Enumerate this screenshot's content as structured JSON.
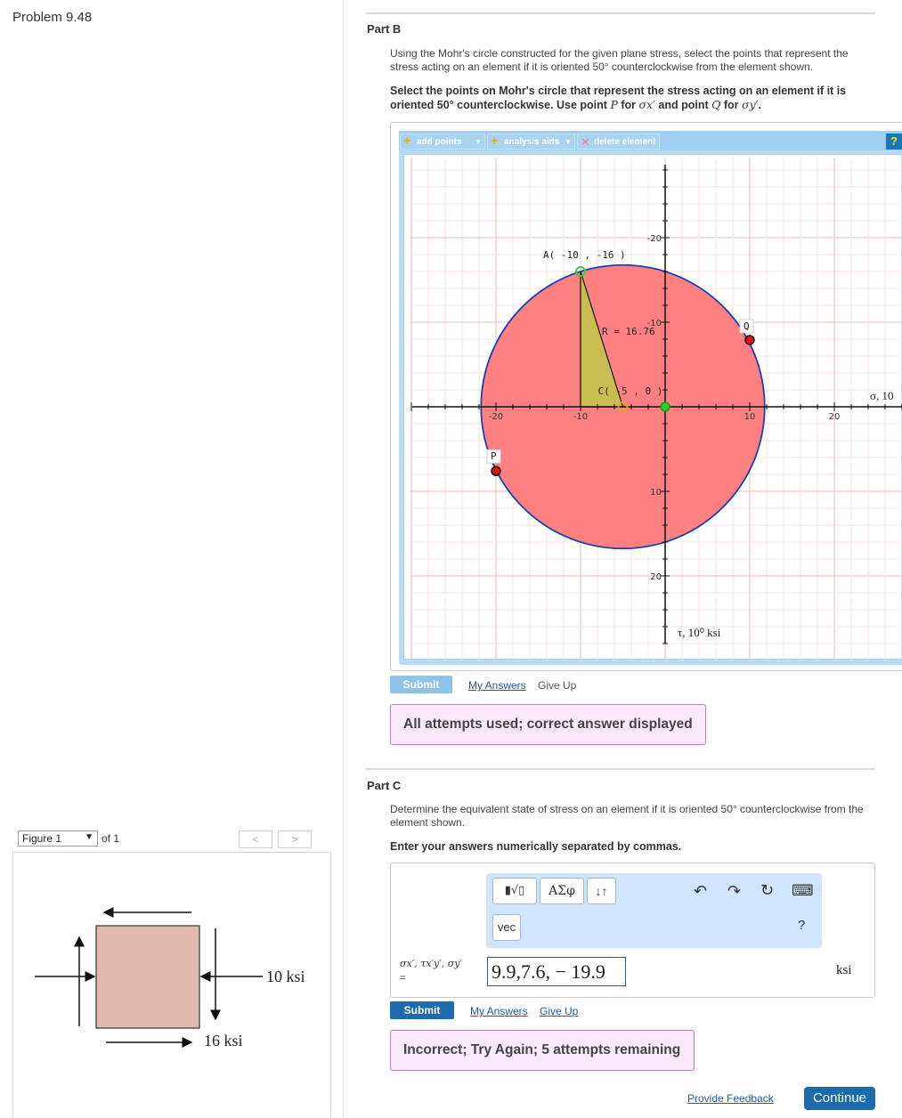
{
  "left_panel": {
    "problem_title": "Problem 9.48",
    "figure_selector": {
      "value": "Figure 1",
      "of_text": "of 1"
    },
    "nav": {
      "prev": "<",
      "next": ">"
    },
    "figure": {
      "label_top": "10 ksi",
      "label_bottom": "16 ksi"
    }
  },
  "part_b": {
    "title": "Part B",
    "description": "Using the Mohr's circle constructed for the given plane stress, select the points that represent the stress acting on an element if it is oriented 50° counterclockwise from the element shown.",
    "instruction_1": "Select the points on Mohr's circle that represent the stress acting on an element if it is oriented 50° counterclockwise. Use point",
    "point_p": "P",
    "instruction_2": "for",
    "sigma_x": "σx′",
    "instruction_3": "and point",
    "point_q": "Q",
    "instruction_4": "for",
    "sigma_y": "σy′",
    "instruction_5": ".",
    "toolbar": {
      "add_points": "add points",
      "analysis_aids": "analysis aids",
      "delete_element": "delete element",
      "help": "?"
    },
    "submit_label": "Submit",
    "my_answers_label": "My Answers",
    "give_up_label": "Give Up",
    "feedback": "All attempts used; correct answer displayed"
  },
  "chart_data": {
    "type": "scatter",
    "x_axis_label": "σ, 10",
    "y_axis_label": "τ, 10⁰ ksi",
    "xlim": [
      -30,
      28
    ],
    "ylim": [
      -29,
      30
    ],
    "y_inverted": true,
    "grid": true,
    "x_ticks": [
      -20,
      -10,
      10,
      20
    ],
    "y_ticks": [
      -20,
      -10,
      10,
      20
    ],
    "circle": {
      "center": [
        -5,
        0
      ],
      "radius": 16.76,
      "fill": "#ff8080",
      "stroke": "#1a3fb5"
    },
    "triangle": [
      [
        -10,
        -16
      ],
      [
        -10,
        0
      ],
      [
        -5,
        0
      ]
    ],
    "triangle_fill": "#c9bd52",
    "points": [
      {
        "name": "A",
        "x": -10,
        "y": -16,
        "label": "A( -10 , -16 )",
        "color": "#3ccc3c"
      },
      {
        "name": "C",
        "x": -5,
        "y": 0,
        "label": "C( -5 , 0 )",
        "color": "#e8a020"
      },
      {
        "name": "origin",
        "x": 0,
        "y": 0,
        "label": "",
        "color": "#2bcc2b"
      },
      {
        "name": "Q",
        "x": 10,
        "y": -7.9,
        "label": "Q",
        "color": "#e01010"
      },
      {
        "name": "P",
        "x": -20,
        "y": 7.6,
        "label": "P",
        "color": "#e01010"
      }
    ],
    "radius_label": "R = 16.76"
  },
  "part_c": {
    "title": "Part C",
    "description": "Determine the equivalent state of stress on an element if it is oriented 50° counterclockwise from the element shown.",
    "instruction": "Enter your answers numerically separated by commas.",
    "editor": {
      "templates": "▮√▯",
      "greek": "ΑΣφ",
      "updown": "↓↑",
      "vec": "vec",
      "undo": "↶",
      "redo": "↷",
      "reset": "↻",
      "keyboard": "⌨",
      "help": "?"
    },
    "answer_label": "σx′, τx′y′, σy′",
    "answer_eq": "=",
    "answer_value": "9.9,7.6, − 19.9",
    "unit": "ksi",
    "submit_label": "Submit",
    "my_answers_label": "My Answers",
    "give_up_label": "Give Up",
    "feedback": "Incorrect; Try Again; 5 attempts remaining"
  },
  "footer": {
    "provide_feedback": "Provide Feedback",
    "continue": "Continue"
  },
  "colors": {
    "submit_b": "#8ec3ea",
    "submit_c": "#1d6aad",
    "accent": "#1d6aad",
    "feedback_bg": "#fbe8fb"
  }
}
